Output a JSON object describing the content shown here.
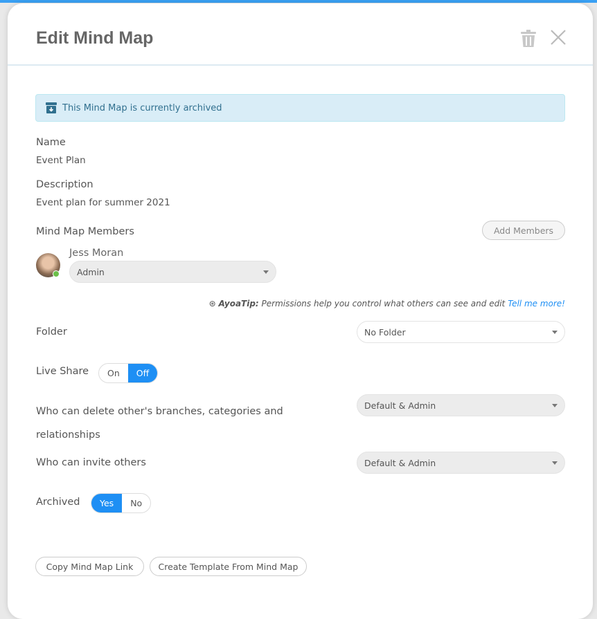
{
  "title": "Edit Mind Map",
  "alert": "This Mind Map is currently archived",
  "name": {
    "label": "Name",
    "value": "Event Plan"
  },
  "description": {
    "label": "Description",
    "value": "Event plan for summer 2021"
  },
  "members": {
    "label": "Mind Map Members",
    "add_button": "Add Members",
    "list": [
      {
        "name": "Jess Moran",
        "role": "Admin",
        "status": "online"
      }
    ]
  },
  "tip": {
    "prefix": "AyoaTip:",
    "text": " Permissions help you control what others can see and edit",
    "link": "Tell me more!"
  },
  "folder": {
    "label": "Folder",
    "value": "No Folder"
  },
  "live_share": {
    "label": "Live Share",
    "options": [
      "On",
      "Off"
    ],
    "selected": "Off"
  },
  "delete_perm": {
    "label": "Who can delete other's branches, categories and relationships",
    "value": "Default & Admin"
  },
  "invite_perm": {
    "label": "Who can invite others",
    "value": "Default & Admin"
  },
  "archived": {
    "label": "Archived",
    "options": [
      "Yes",
      "No"
    ],
    "selected": "Yes"
  },
  "footer": {
    "copy_link": "Copy Mind Map Link",
    "create_template": "Create Template From Mind Map"
  },
  "colors": {
    "accent": "#1e8ff4",
    "alert_bg": "#d9edf7",
    "alert_text": "#31708f"
  }
}
